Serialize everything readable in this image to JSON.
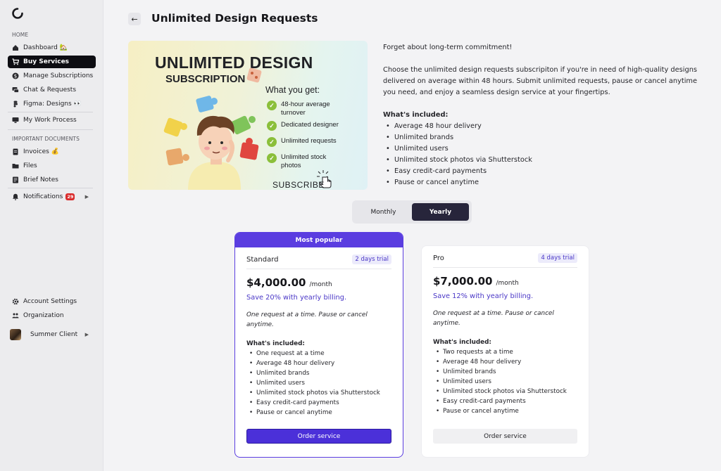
{
  "sidebar": {
    "sections": {
      "home": "HOME",
      "docs": "IMPORTANT DOCUMENTS"
    },
    "items": [
      {
        "label": "Dashboard",
        "emoji": "🏡",
        "icon": "home-icon"
      },
      {
        "label": "Buy Services",
        "icon": "cart-icon",
        "active": true
      },
      {
        "label": "Manage Subscriptions",
        "icon": "dollar-icon"
      },
      {
        "label": "Chat & Requests",
        "icon": "chat-icon"
      },
      {
        "label": "Figma: Designs",
        "emoji": "👀",
        "icon": "figma-icon"
      },
      {
        "label": "My Work Process",
        "icon": "monitor-icon"
      },
      {
        "label": "Invoices",
        "emoji": "💰",
        "icon": "invoice-icon"
      },
      {
        "label": "Files",
        "icon": "folder-icon"
      },
      {
        "label": "Brief Notes",
        "icon": "notes-icon"
      },
      {
        "label": "Notifications",
        "badge": "29",
        "icon": "bell-icon"
      },
      {
        "label": "Account Settings",
        "icon": "gear-icon"
      },
      {
        "label": "Organization",
        "icon": "people-icon"
      },
      {
        "label": "Summer Client",
        "icon": "avatar"
      }
    ]
  },
  "header": {
    "title": "Unlimited Design Requests",
    "back": "←"
  },
  "hero": {
    "title": "UNLIMITED DESIGN",
    "subtitle": "SUBSCRIPTION",
    "get": "What you get:",
    "features": [
      "48-hour average turnover",
      "Dedicated designer",
      "Unlimited requests",
      "Unlimited stock photos"
    ],
    "cta": "SUBSCRIBE"
  },
  "description": {
    "p1": "Forget about long-term commitment!",
    "p2": "Choose the unlimited design requests subscripiton if you're in need of high-quality designs delivered on average within 48 hours. Submit unlimited requests, pause or cancel anytime you need, and enjoy a seamless design service at your fingertips.",
    "included_title": "What's included:",
    "included": [
      "Average 48 hour delivery",
      "Unlimited brands",
      "Unlimited users",
      "Unlimited stock photos via Shutterstock",
      "Easy credit-card payments",
      "Pause or cancel anytime"
    ]
  },
  "billing": {
    "monthly": "Monthly",
    "yearly": "Yearly",
    "selected": "Yearly"
  },
  "plans": {
    "standard": {
      "popular": "Most popular",
      "name": "Standard",
      "trial": "2 days trial",
      "price": "$4,000.00",
      "per": "/month",
      "save": "Save 20% with yearly billing.",
      "desc": "One request at a time. Pause or cancel anytime.",
      "included_title": "What's included:",
      "included": [
        "One request at a time",
        "Average 48 hour delivery",
        "Unlimited brands",
        "Unlimited users",
        "Unlimited stock photos via Shutterstock",
        "Easy credit-card payments",
        "Pause or cancel anytime"
      ],
      "order": "Order service"
    },
    "pro": {
      "name": "Pro",
      "trial": "4 days trial",
      "price": "$7,000.00",
      "per": "/month",
      "save": "Save 12% with yearly billing.",
      "desc": "One request at a time. Pause or cancel anytime.",
      "included_title": "What's included:",
      "included": [
        "Two requests at a time",
        "Average 48 hour delivery",
        "Unlimited brands",
        "Unlimited users",
        "Unlimited stock photos via Shutterstock",
        "Easy credit-card payments",
        "Pause or cancel anytime"
      ],
      "order": "Order service"
    }
  },
  "colors": {
    "accent": "#5a3de0",
    "active_nav": "#0d0d12",
    "check": "#8bbf3a",
    "badge": "#d92b2b"
  }
}
